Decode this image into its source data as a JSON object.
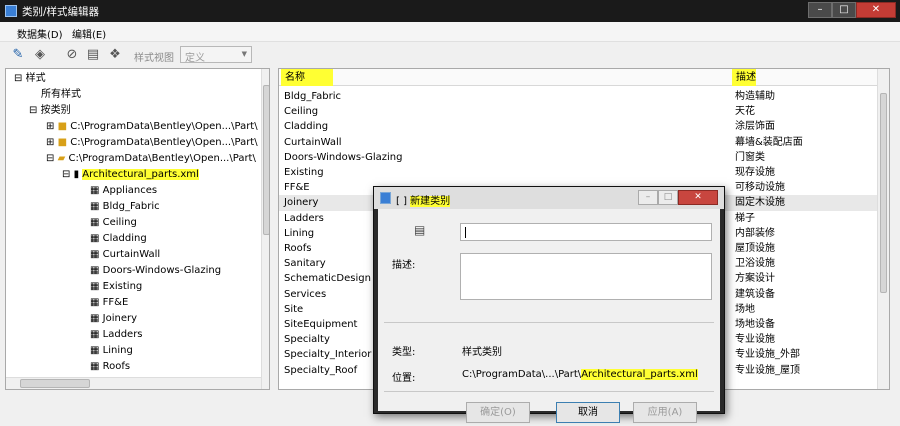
{
  "window": {
    "title": "类别/样式编辑器"
  },
  "menu": [
    "数据集(D)",
    "编辑(E)"
  ],
  "toolbar": {
    "view_label": "样式视图",
    "view_select": "定义"
  },
  "tree": {
    "root": "样式",
    "all_styles": "所有样式",
    "by_category": "按类别",
    "paths": [
      "C:\\ProgramData\\Bentley\\Open...\\Part\\",
      "C:\\ProgramData\\Bentley\\Open...\\Part\\",
      "C:\\ProgramData\\Bentley\\Open...\\Part\\"
    ],
    "file": "Architectural_parts.xml",
    "children": [
      "Appliances",
      "Bldg_Fabric",
      "Ceiling",
      "Cladding",
      "CurtainWall",
      "Doors-Windows-Glazing",
      "Existing",
      "FF&E",
      "Joinery",
      "Ladders",
      "Lining",
      "Roofs"
    ]
  },
  "grid": {
    "headers": {
      "name": "名称",
      "desc": "描述"
    },
    "rows": [
      {
        "name": "Bldg_Fabric",
        "desc": "构造辅助"
      },
      {
        "name": "Ceiling",
        "desc": "天花"
      },
      {
        "name": "Cladding",
        "desc": "涂层饰面"
      },
      {
        "name": "CurtainWall",
        "desc": "幕墙&装配店面"
      },
      {
        "name": "Doors-Windows-Glazing",
        "desc": "门窗类"
      },
      {
        "name": "Existing",
        "desc": "现存设施"
      },
      {
        "name": "FF&E",
        "desc": "可移动设施"
      },
      {
        "name": "Joinery",
        "desc": "固定木设施"
      },
      {
        "name": "Ladders",
        "desc": "梯子"
      },
      {
        "name": "Lining",
        "desc": "内部装修"
      },
      {
        "name": "Roofs",
        "desc": "屋顶设施"
      },
      {
        "name": "Sanitary",
        "desc": "卫浴设施"
      },
      {
        "name": "SchematicDesign",
        "desc": "方案设计"
      },
      {
        "name": "Services",
        "desc": "建筑设备"
      },
      {
        "name": "Site",
        "desc": "场地"
      },
      {
        "name": "SiteEquipment",
        "desc": "场地设备"
      },
      {
        "name": "Specialty",
        "desc": "专业设施"
      },
      {
        "name": "Specialty_Interior",
        "desc": "专业设施_外部"
      },
      {
        "name": "Specialty_Roof",
        "desc": "专业设施_屋顶"
      }
    ]
  },
  "dialog": {
    "title_prefix": "[ ]",
    "title": "新建类别",
    "desc_label": "描述:",
    "type_label": "类型:",
    "type_value": "样式类别",
    "location_label": "位置:",
    "location_prefix": "C:\\ProgramData\\...\\Part\\",
    "location_file": "Architectural_parts.xml",
    "ok": "确定(O)",
    "cancel": "取消",
    "apply": "应用(A)"
  }
}
